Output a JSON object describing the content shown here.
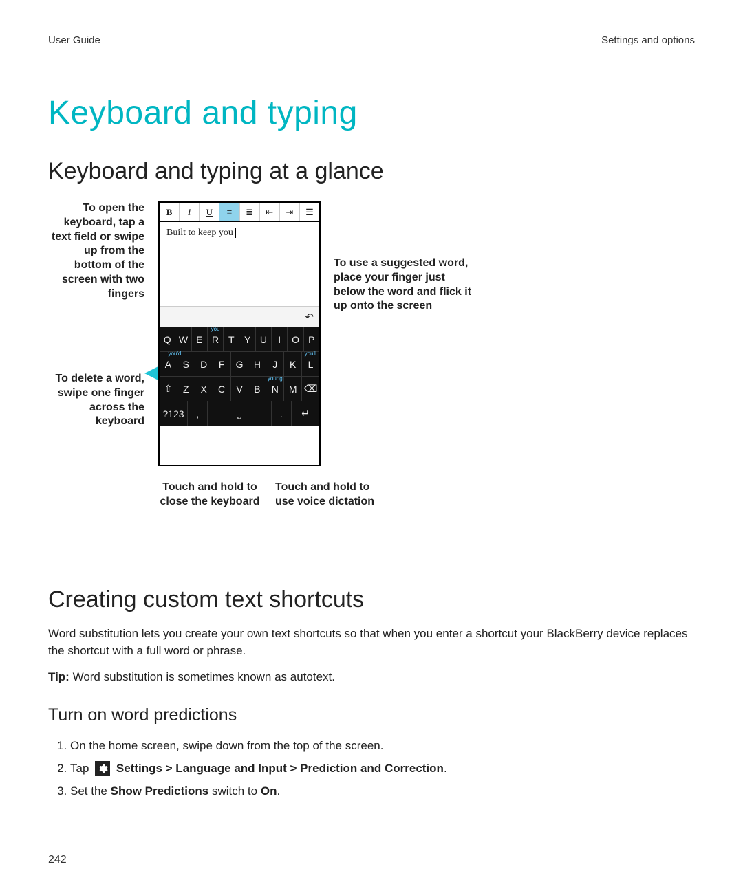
{
  "header": {
    "left": "User Guide",
    "right": "Settings and options"
  },
  "title": "Keyboard and typing",
  "section_glance": "Keyboard and typing at a glance",
  "annotations": {
    "open_keyboard": "To open the keyboard, tap a text field or swipe up from the bottom of the screen with two fingers",
    "delete_word": "To delete a word, swipe one finger across the keyboard",
    "suggested_word": "To use a suggested word, place your finger just below the word and flick it up onto the screen",
    "close_keyboard": "Touch and hold to close the keyboard",
    "voice_dictation": "Touch and hold to use voice dictation"
  },
  "phone": {
    "toolbar": {
      "b": "B",
      "i": "I",
      "u": "U"
    },
    "text_content": "Built to keep you",
    "undo_glyph": "↶",
    "suggestions": {
      "r1": "you",
      "r2a": "you'd",
      "r2b": "you'll",
      "r3": "young"
    },
    "rows": {
      "r1": [
        "Q",
        "W",
        "E",
        "R",
        "T",
        "Y",
        "U",
        "I",
        "O",
        "P"
      ],
      "r2": [
        "A",
        "S",
        "D",
        "F",
        "G",
        "H",
        "J",
        "K",
        "L"
      ],
      "r3": [
        "⇧",
        "Z",
        "X",
        "C",
        "V",
        "B",
        "N",
        "M",
        "⌫"
      ],
      "r4": [
        "?123",
        ",",
        "␣",
        ".",
        "↵"
      ]
    }
  },
  "section_shortcuts": "Creating custom text shortcuts",
  "shortcuts_body": "Word substitution lets you create your own text shortcuts so that when you enter a shortcut your BlackBerry device replaces the shortcut with a full word or phrase.",
  "tip_label": "Tip:",
  "tip_body": " Word substitution is sometimes known as autotext.",
  "sub_predictions": "Turn on word predictions",
  "steps": {
    "s1": "On the home screen, swipe down from the top of the screen.",
    "s2_prefix": "Tap ",
    "s2_bold": " Settings > Language and Input > Prediction and Correction",
    "s2_suffix": ".",
    "s3_prefix": "Set the ",
    "s3_b1": "Show Predictions",
    "s3_mid": " switch to ",
    "s3_b2": "On",
    "s3_suffix": "."
  },
  "page_number": "242"
}
